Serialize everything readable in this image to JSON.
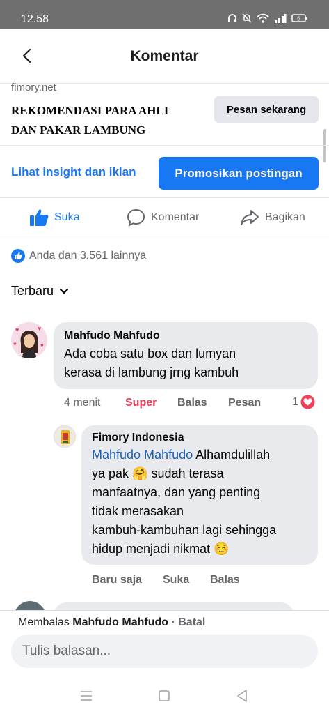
{
  "status_bar": {
    "time": "12.58",
    "battery": "6"
  },
  "header": {
    "title": "Komentar"
  },
  "ad": {
    "domain": "fimory.net",
    "headline_line1": "REKOMENDASI PARA AHLI",
    "headline_line2": "DAN PAKAR LAMBUNG",
    "cta_label": "Pesan sekarang"
  },
  "promo": {
    "insight_link": "Lihat insight dan iklan",
    "promote_label": "Promosikan postingan"
  },
  "actions": {
    "like": "Suka",
    "comment": "Komentar",
    "share": "Bagikan"
  },
  "reactions": {
    "summary": "Anda dan 3.561 lainnya"
  },
  "sort": {
    "label": "Terbaru"
  },
  "comments": [
    {
      "author": "Mahfudo Mahfudo",
      "text_line1": "Ada coba satu box dan lumyan",
      "text_line2": "kerasa di lambung jrng kambuh",
      "time": "4 menit",
      "reaction_label": "Super",
      "reply_label": "Balas",
      "message_label": "Pesan",
      "reaction_count": "1"
    }
  ],
  "reply": {
    "author": "Fimory Indonesia",
    "mention": "Mahfudo Mahfudo",
    "line1_rest": " Alhamdulillah",
    "line2": "ya pak",
    "line2_rest": " sudah terasa",
    "line3": "manfaatnya, dan yang penting",
    "line4": "tidak merasakan",
    "line5": "kambuh-kambuhan lagi sehingga",
    "line6": "hidup menjadi nikmat",
    "emoji1": "🤗",
    "emoji2": "☺️",
    "time": "Baru saja",
    "like_label": "Suka",
    "reply_label": "Balas"
  },
  "reply_bar": {
    "prefix": "Membalas",
    "target": "Mahfudo Mahfudo",
    "separator": " · ",
    "cancel": "Batal",
    "placeholder": "Tulis balasan..."
  },
  "colors": {
    "brand_blue": "#1877f2",
    "super_red": "#e43d56",
    "bubble_bg": "#e9eaee",
    "status_bar": "#6f6f6f"
  }
}
